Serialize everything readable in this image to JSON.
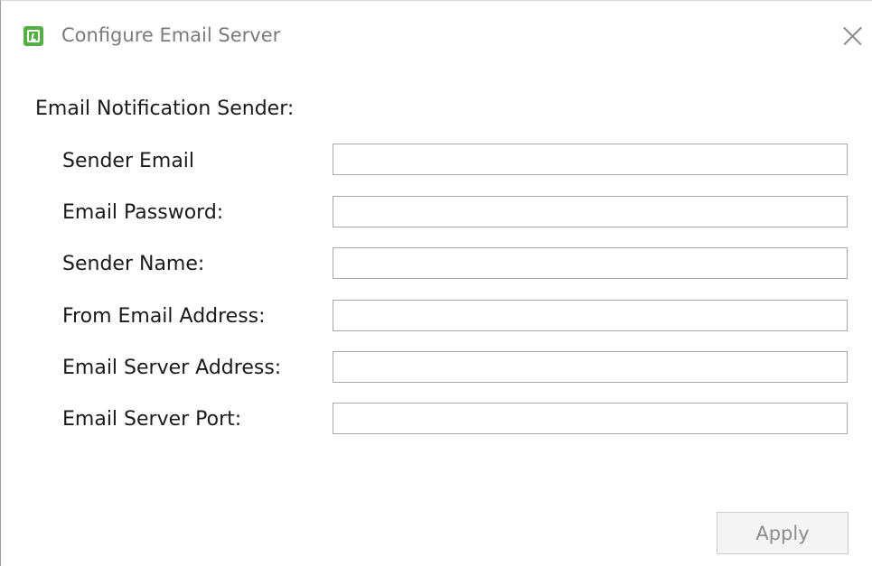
{
  "window": {
    "title": "Configure Email Server",
    "app_icon": "green-app-icon",
    "close_icon": "close-icon"
  },
  "form": {
    "section_heading": "Email Notification Sender:",
    "fields": [
      {
        "label": "Sender Email",
        "value": "",
        "placeholder": ""
      },
      {
        "label": "Email Password:",
        "value": "",
        "placeholder": ""
      },
      {
        "label": "Sender Name:",
        "value": "",
        "placeholder": ""
      },
      {
        "label": "From Email Address:",
        "value": "",
        "placeholder": ""
      },
      {
        "label": "Email Server Address:",
        "value": "",
        "placeholder": ""
      },
      {
        "label": "Email Server Port:",
        "value": "",
        "placeholder": ""
      }
    ]
  },
  "actions": {
    "apply_label": "Apply",
    "apply_disabled": true
  },
  "colors": {
    "app_icon": "#52b043",
    "text": "#1a1a1a",
    "title_text": "#7a7a7a",
    "disabled_text": "#8c8c8c",
    "input_border": "#a9a9a9"
  }
}
